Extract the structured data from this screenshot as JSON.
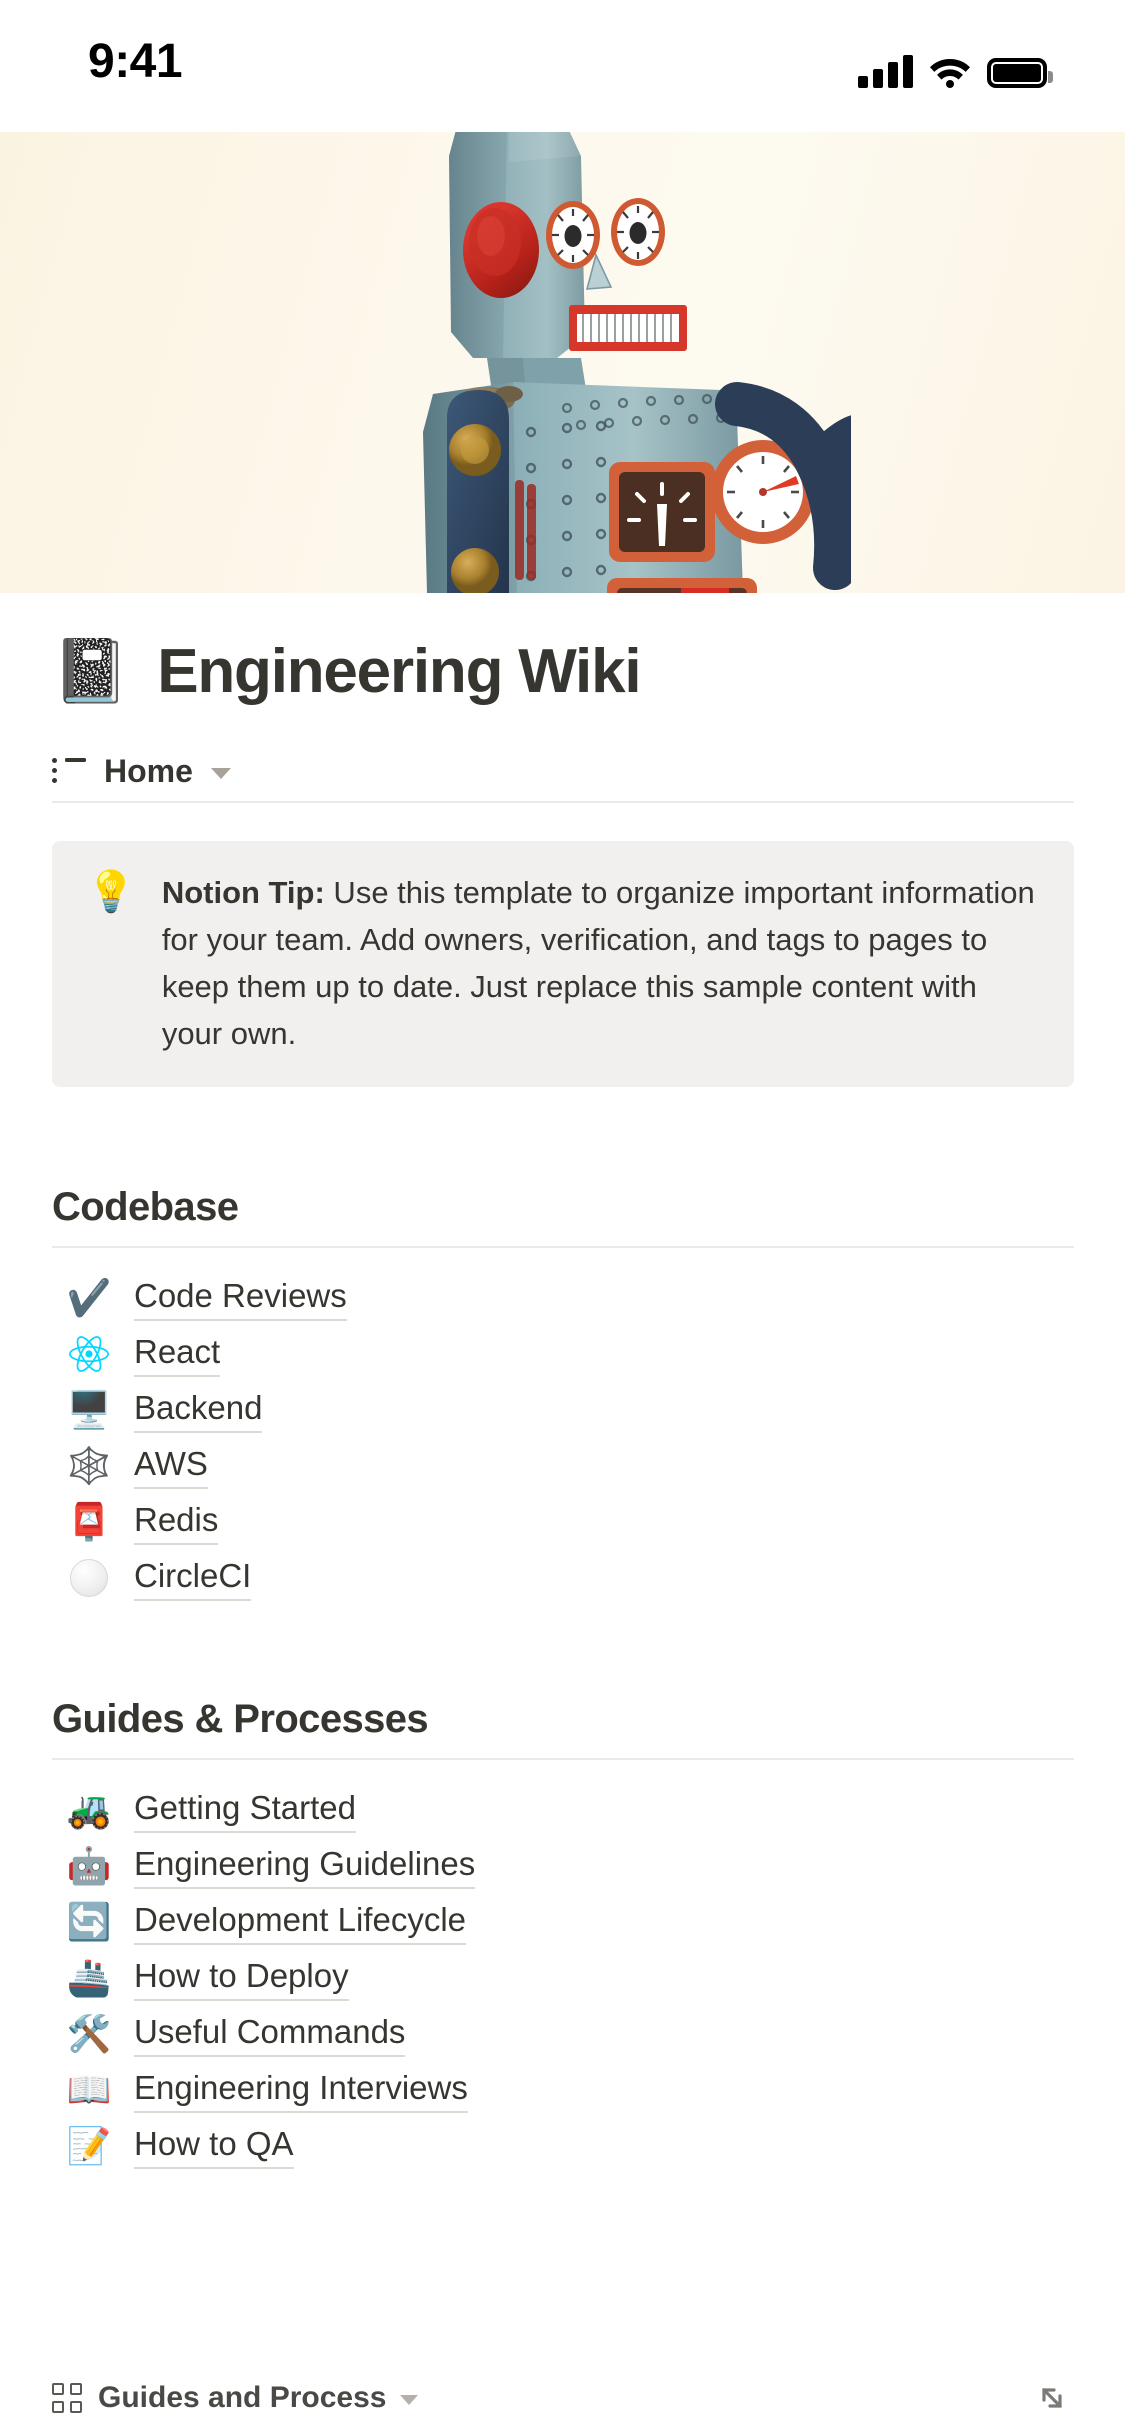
{
  "status_bar": {
    "time": "9:41",
    "signal_icon": "cellular-signal-icon",
    "wifi_icon": "wifi-icon",
    "battery_icon": "battery-icon"
  },
  "cover": {
    "alt": "vintage tin toy robot on cream background",
    "background_color": "#fdf7ea"
  },
  "page": {
    "icon": "📓",
    "title": "Engineering Wiki"
  },
  "view_row": {
    "icon": "list-view-icon",
    "label": "Home",
    "chevron": "chevron-down-icon"
  },
  "callout": {
    "icon": "💡",
    "lead": "Notion Tip:",
    "body": " Use this template to organize important information for your team. Add owners, verification, and tags to pages to keep them up to date. Just replace this sample content with your own."
  },
  "sections": [
    {
      "title": "Codebase",
      "items": [
        {
          "emoji": "✔️",
          "icon_name": "check-mark-icon",
          "label": "Code Reviews"
        },
        {
          "emoji": "",
          "icon_name": "react-logo-icon",
          "label": "React"
        },
        {
          "emoji": "🖥️",
          "icon_name": "desktop-computer-icon",
          "label": "Backend"
        },
        {
          "emoji": "🕸️",
          "icon_name": "spider-web-icon",
          "label": "AWS"
        },
        {
          "emoji": "📮",
          "icon_name": "postbox-icon",
          "label": "Redis"
        },
        {
          "emoji": "",
          "icon_name": "white-circle-icon",
          "label": "CircleCI"
        }
      ]
    },
    {
      "title": "Guides & Processes",
      "items": [
        {
          "emoji": "🚜",
          "icon_name": "tractor-icon",
          "label": "Getting Started"
        },
        {
          "emoji": "🤖",
          "icon_name": "robot-face-icon",
          "label": "Engineering Guidelines"
        },
        {
          "emoji": "🔄",
          "icon_name": "counterclockwise-arrows-icon",
          "label": "Development Lifecycle"
        },
        {
          "emoji": "🚢",
          "icon_name": "ship-icon",
          "label": "How to Deploy"
        },
        {
          "emoji": "🛠️",
          "icon_name": "hammer-and-wrench-icon",
          "label": "Useful Commands"
        },
        {
          "emoji": "📖",
          "icon_name": "open-book-icon",
          "label": "Engineering Interviews"
        },
        {
          "emoji": "📝",
          "icon_name": "memo-icon",
          "label": "How to QA"
        }
      ]
    }
  ],
  "bottom_bar": {
    "icon": "gallery-grid-icon",
    "label": "Guides and Process",
    "chevron": "chevron-down-icon",
    "expand": "expand-diagonal-icon"
  },
  "colors": {
    "text": "#37352f",
    "callout_bg": "#f1f0ee",
    "rule": "#eceae6",
    "cover_cream": "#fdf7ea",
    "react_blue": "#00d8ff"
  }
}
